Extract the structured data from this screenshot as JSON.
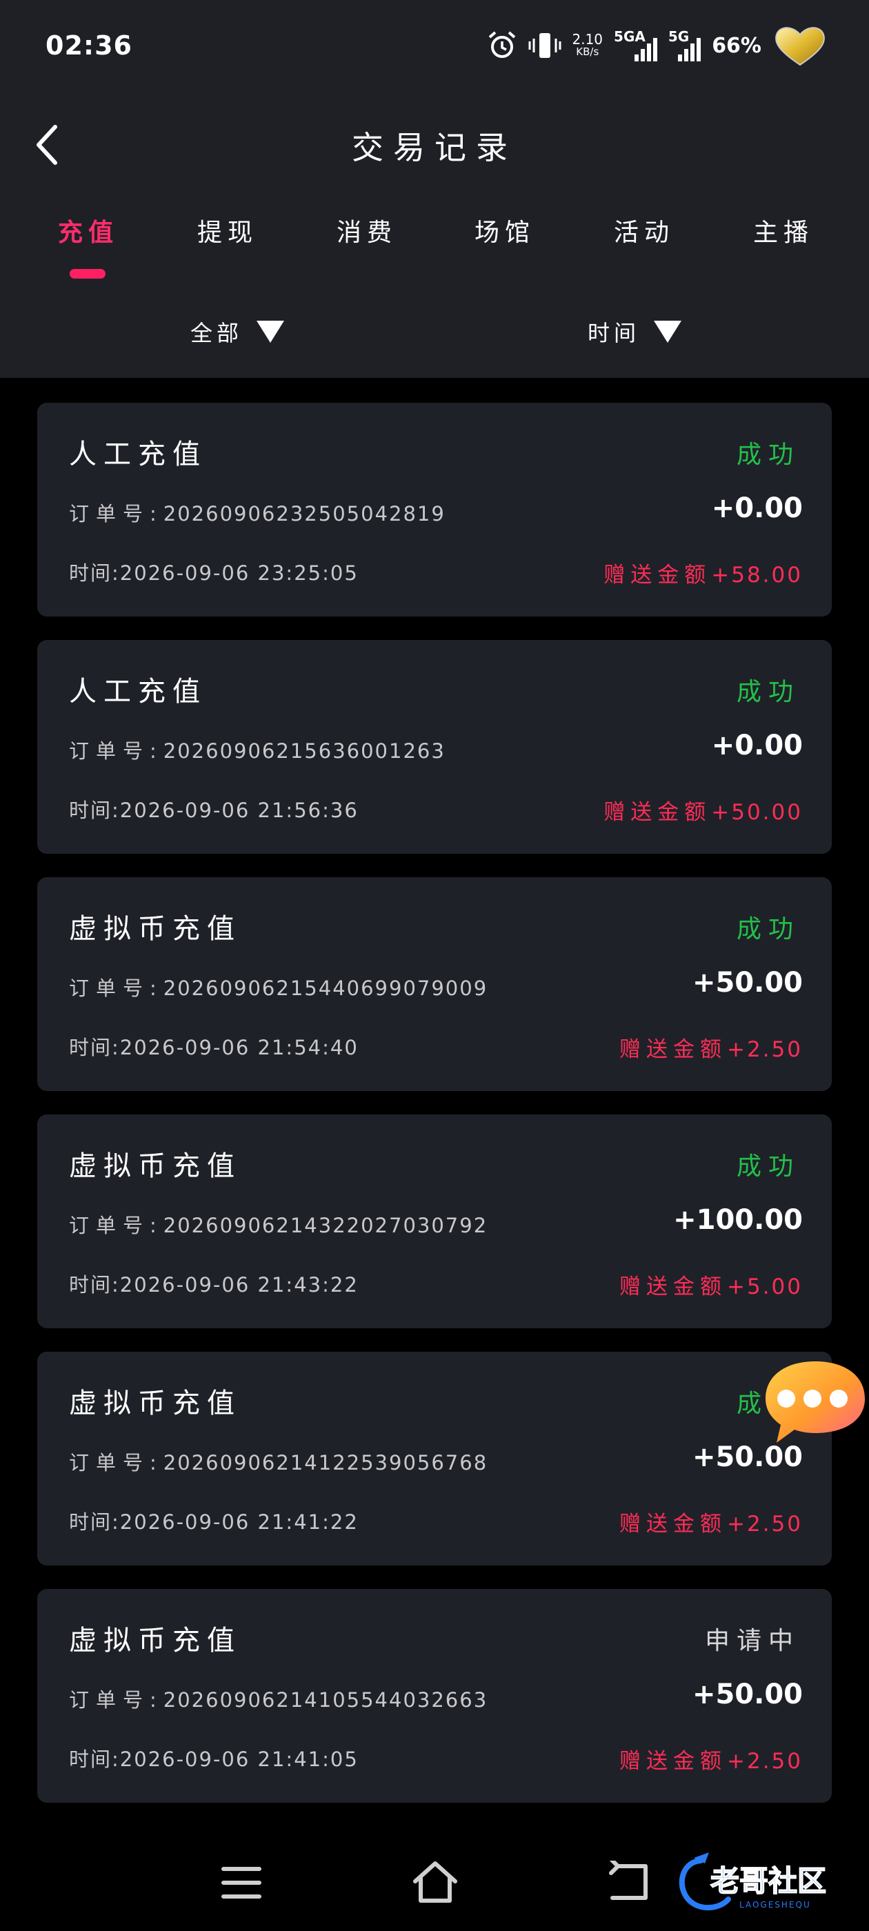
{
  "status_bar": {
    "time": "02:36",
    "speed_value": "2.10",
    "speed_unit": "KB/s",
    "net1": "5GA",
    "net2": "5G",
    "battery": "66%"
  },
  "header": {
    "title": "交易记录",
    "tabs": [
      {
        "label": "充值",
        "active": true
      },
      {
        "label": "提现",
        "active": false
      },
      {
        "label": "消费",
        "active": false
      },
      {
        "label": "场馆",
        "active": false
      },
      {
        "label": "活动",
        "active": false
      },
      {
        "label": "主播",
        "active": false
      }
    ],
    "filters": {
      "type": "全部",
      "time": "时间"
    }
  },
  "labels": {
    "order_prefix": "订单号:",
    "time_prefix": "时间:",
    "bonus_prefix": "赠送金额"
  },
  "records": [
    {
      "title": "人工充值",
      "status": "成功",
      "status_color": "#22c04a",
      "order_no": "2026090623250504281​9",
      "amount": "+0.00",
      "time": "2026-09-06 23:25:05",
      "bonus": "+58.00"
    },
    {
      "title": "人工充值",
      "status": "成功",
      "status_color": "#22c04a",
      "order_no": "20260906215636001263",
      "amount": "+0.00",
      "time": "2026-09-06 21:56:36",
      "bonus": "+50.00"
    },
    {
      "title": "虚拟币充值",
      "status": "成功",
      "status_color": "#22c04a",
      "order_no": "2026090621544069907900​9",
      "amount": "+50.00",
      "time": "2026-09-06 21:54:40",
      "bonus": "+2.50"
    },
    {
      "title": "虚拟币充值",
      "status": "成功",
      "status_color": "#22c04a",
      "order_no": "2026090621432202703079​2",
      "amount": "+100.00",
      "time": "2026-09-06 21:43:22",
      "bonus": "+5.00"
    },
    {
      "title": "虚拟币充值",
      "status": "成功",
      "status_color": "#22c04a",
      "order_no": "2026090621412253905676​8",
      "amount": "+50.00",
      "time": "2026-09-06 21:41:22",
      "bonus": "+2.50"
    },
    {
      "title": "虚拟币充值",
      "status": "申请中",
      "status_color": "#d8d8d8",
      "order_no": "2026090621410554403266​3",
      "amount": "+50.00",
      "time": "2026-09-06 21:41:05",
      "bonus": "+2.50"
    }
  ],
  "watermark": {
    "text": "老哥社区",
    "subtext": "LAOGESHEQU"
  },
  "colors": {
    "accent": "#ff1f63",
    "success": "#22c04a",
    "bonus": "#ff2d56",
    "card_bg": "#1f2128",
    "header_bg": "#1f2026"
  }
}
